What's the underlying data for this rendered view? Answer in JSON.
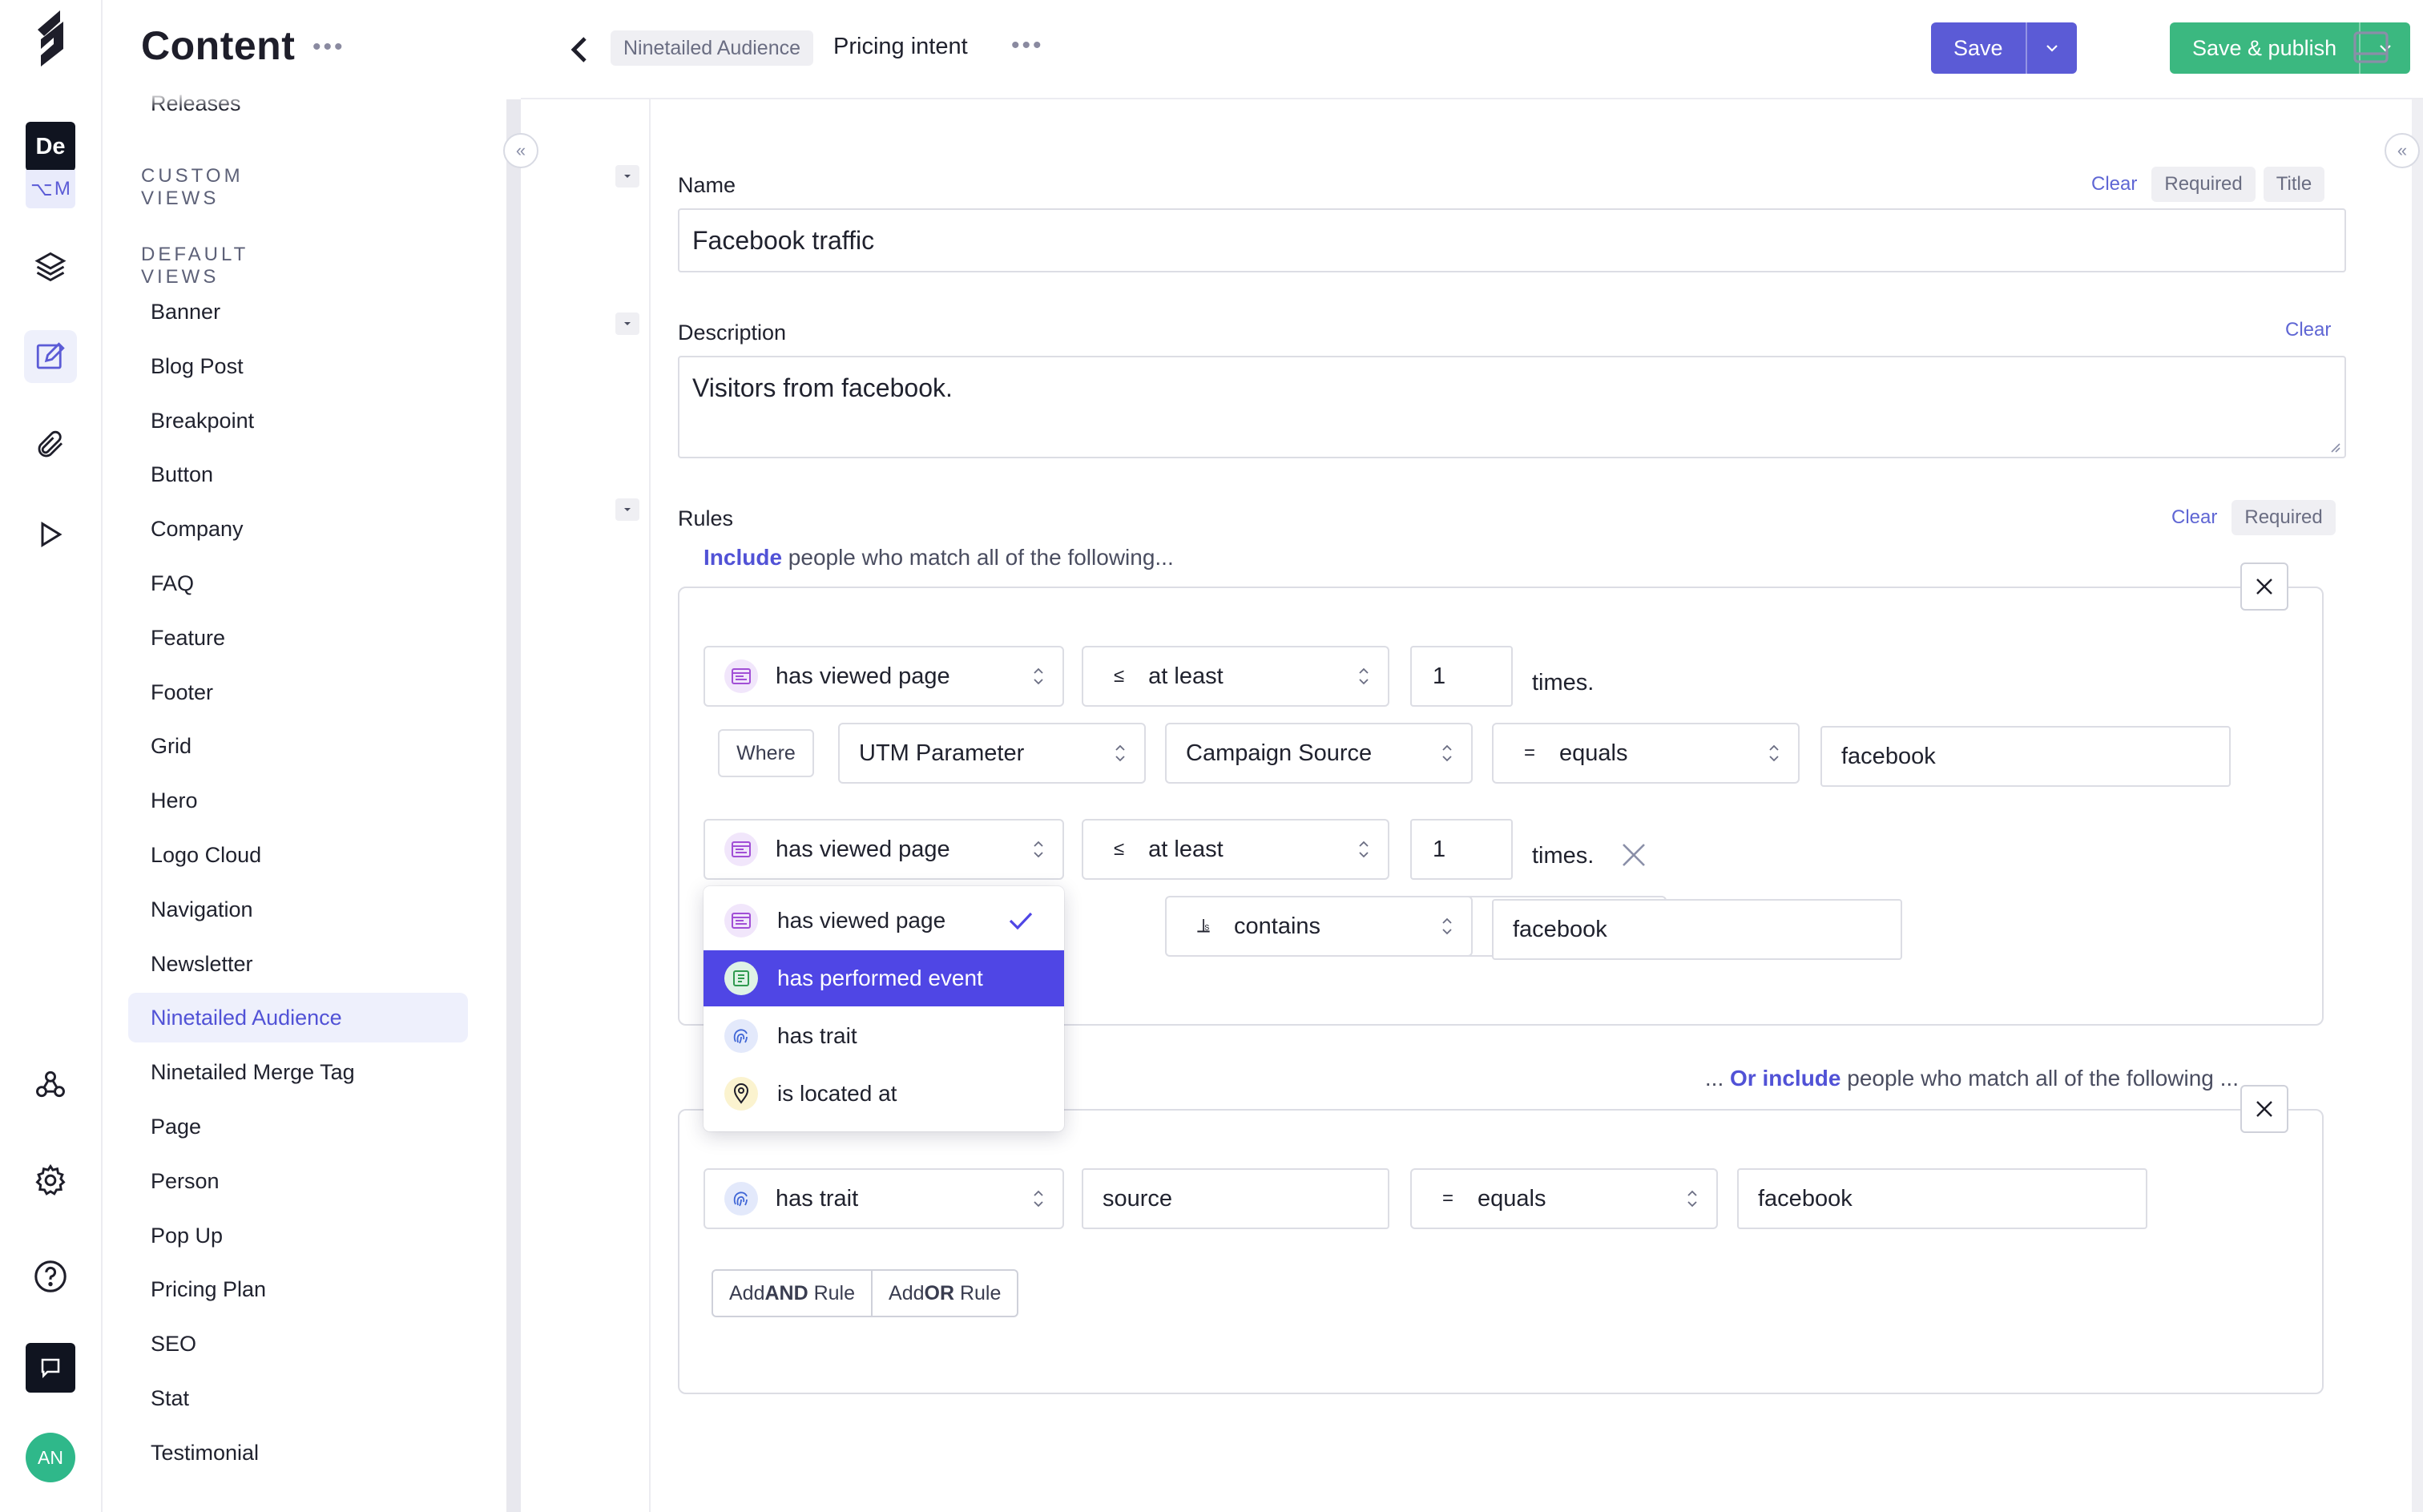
{
  "rail": {
    "workspace_badge": "De",
    "merge_label": "M",
    "avatar_initials": "AN"
  },
  "sidebar": {
    "title": "Content",
    "more": "•••",
    "partial_item": "Releases",
    "custom_views_heading": "CUSTOM VIEWS",
    "default_views_heading": "DEFAULT VIEWS",
    "items": [
      {
        "label": "Banner"
      },
      {
        "label": "Blog Post"
      },
      {
        "label": "Breakpoint"
      },
      {
        "label": "Button"
      },
      {
        "label": "Company"
      },
      {
        "label": "FAQ"
      },
      {
        "label": "Feature"
      },
      {
        "label": "Footer"
      },
      {
        "label": "Grid"
      },
      {
        "label": "Hero"
      },
      {
        "label": "Logo Cloud"
      },
      {
        "label": "Navigation"
      },
      {
        "label": "Newsletter"
      },
      {
        "label": "Ninetailed Audience",
        "active": true
      },
      {
        "label": "Ninetailed Merge Tag"
      },
      {
        "label": "Page"
      },
      {
        "label": "Person"
      },
      {
        "label": "Pop Up"
      },
      {
        "label": "Pricing Plan"
      },
      {
        "label": "SEO"
      },
      {
        "label": "Stat"
      },
      {
        "label": "Testimonial"
      }
    ]
  },
  "header": {
    "breadcrumb_model": "Ninetailed Audience",
    "entry_title": "Pricing intent",
    "more": "•••",
    "save_label": "Save",
    "save_publish_label": "Save & publish",
    "save_color": "#5b5bd6",
    "publish_color": "#3bb880"
  },
  "fields": {
    "name": {
      "label": "Name",
      "clear": "Clear",
      "required": "Required",
      "title_tag": "Title",
      "value": "Facebook traffic"
    },
    "description": {
      "label": "Description",
      "clear": "Clear",
      "value": "Visitors from facebook."
    },
    "rules": {
      "label": "Rules",
      "clear": "Clear",
      "required": "Required",
      "include_keyword": "Include",
      "include_rest": " people who match all of the following...",
      "or_prefix": "... ",
      "or_keyword": "Or include",
      "or_rest": " people who match all of the following ...",
      "group1": {
        "rule1": {
          "condition": "has viewed page",
          "operator_symbol": "≤",
          "operator": "at least",
          "count": "1",
          "suffix": "times.",
          "where_label": "Where",
          "property": "UTM Parameter",
          "subproperty": "Campaign Source",
          "match_symbol": "=",
          "match": "equals",
          "value": "facebook"
        },
        "rule2": {
          "condition": "has viewed page",
          "operator_symbol": "≤",
          "operator": "at least",
          "count": "1",
          "suffix": "times.",
          "match_symbol": "⫡",
          "match": "contains",
          "value": "facebook"
        }
      },
      "group2": {
        "rule1": {
          "condition": "has trait",
          "trait": "source",
          "match_symbol": "=",
          "match": "equals",
          "value": "facebook"
        }
      },
      "add_and_prefix": "Add ",
      "add_and_bold": "AND",
      "add_and_suffix": " Rule",
      "add_or_prefix": "Add ",
      "add_or_bold": "OR",
      "add_or_suffix": " Rule"
    }
  },
  "dropdown": {
    "options": [
      {
        "label": "has viewed page",
        "icon": "page-icon",
        "selected": true
      },
      {
        "label": "has performed event",
        "icon": "event-icon",
        "highlighted": true
      },
      {
        "label": "has trait",
        "icon": "fingerprint-icon"
      },
      {
        "label": "is located at",
        "icon": "location-pin-icon"
      }
    ]
  },
  "colors": {
    "accent": "#5b5bd6",
    "publish": "#3bb880",
    "highlight": "#4f46e5"
  }
}
